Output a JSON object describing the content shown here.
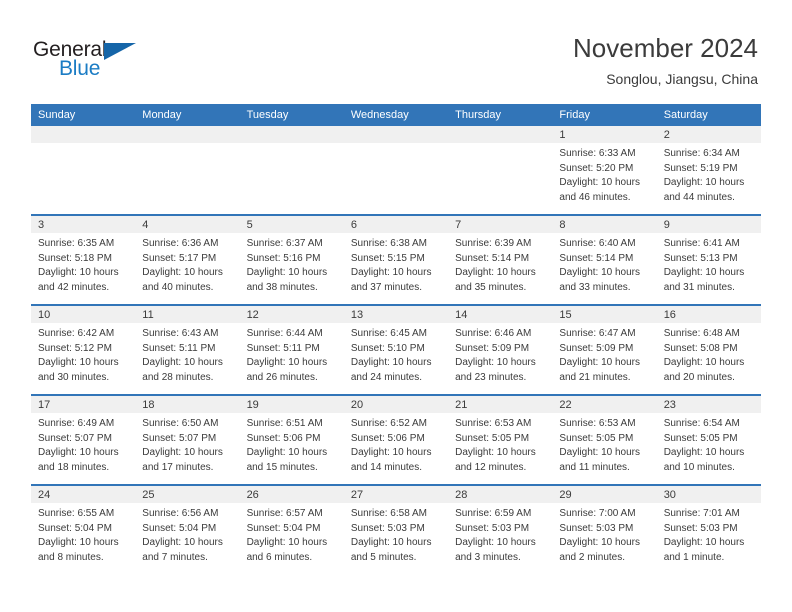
{
  "brand": {
    "name_part1": "General",
    "name_part2": "Blue",
    "triangle_icon": "triangle-icon",
    "color_dark": "#231f20",
    "color_blue": "#1b7cc4"
  },
  "header": {
    "title": "November 2024",
    "subtitle": "Songlou, Jiangsu, China"
  },
  "theme": {
    "header_blue": "#3275b8",
    "day_band_gray": "#f0f0f0",
    "text": "#3b3b3b"
  },
  "weekdays": [
    "Sunday",
    "Monday",
    "Tuesday",
    "Wednesday",
    "Thursday",
    "Friday",
    "Saturday"
  ],
  "weeks": [
    [
      {
        "day": "",
        "empty": true
      },
      {
        "day": "",
        "empty": true
      },
      {
        "day": "",
        "empty": true
      },
      {
        "day": "",
        "empty": true
      },
      {
        "day": "",
        "empty": true
      },
      {
        "day": "1",
        "sunrise": "Sunrise: 6:33 AM",
        "sunset": "Sunset: 5:20 PM",
        "daylight": "Daylight: 10 hours and 46 minutes."
      },
      {
        "day": "2",
        "sunrise": "Sunrise: 6:34 AM",
        "sunset": "Sunset: 5:19 PM",
        "daylight": "Daylight: 10 hours and 44 minutes."
      }
    ],
    [
      {
        "day": "3",
        "sunrise": "Sunrise: 6:35 AM",
        "sunset": "Sunset: 5:18 PM",
        "daylight": "Daylight: 10 hours and 42 minutes."
      },
      {
        "day": "4",
        "sunrise": "Sunrise: 6:36 AM",
        "sunset": "Sunset: 5:17 PM",
        "daylight": "Daylight: 10 hours and 40 minutes."
      },
      {
        "day": "5",
        "sunrise": "Sunrise: 6:37 AM",
        "sunset": "Sunset: 5:16 PM",
        "daylight": "Daylight: 10 hours and 38 minutes."
      },
      {
        "day": "6",
        "sunrise": "Sunrise: 6:38 AM",
        "sunset": "Sunset: 5:15 PM",
        "daylight": "Daylight: 10 hours and 37 minutes."
      },
      {
        "day": "7",
        "sunrise": "Sunrise: 6:39 AM",
        "sunset": "Sunset: 5:14 PM",
        "daylight": "Daylight: 10 hours and 35 minutes."
      },
      {
        "day": "8",
        "sunrise": "Sunrise: 6:40 AM",
        "sunset": "Sunset: 5:14 PM",
        "daylight": "Daylight: 10 hours and 33 minutes."
      },
      {
        "day": "9",
        "sunrise": "Sunrise: 6:41 AM",
        "sunset": "Sunset: 5:13 PM",
        "daylight": "Daylight: 10 hours and 31 minutes."
      }
    ],
    [
      {
        "day": "10",
        "sunrise": "Sunrise: 6:42 AM",
        "sunset": "Sunset: 5:12 PM",
        "daylight": "Daylight: 10 hours and 30 minutes."
      },
      {
        "day": "11",
        "sunrise": "Sunrise: 6:43 AM",
        "sunset": "Sunset: 5:11 PM",
        "daylight": "Daylight: 10 hours and 28 minutes."
      },
      {
        "day": "12",
        "sunrise": "Sunrise: 6:44 AM",
        "sunset": "Sunset: 5:11 PM",
        "daylight": "Daylight: 10 hours and 26 minutes."
      },
      {
        "day": "13",
        "sunrise": "Sunrise: 6:45 AM",
        "sunset": "Sunset: 5:10 PM",
        "daylight": "Daylight: 10 hours and 24 minutes."
      },
      {
        "day": "14",
        "sunrise": "Sunrise: 6:46 AM",
        "sunset": "Sunset: 5:09 PM",
        "daylight": "Daylight: 10 hours and 23 minutes."
      },
      {
        "day": "15",
        "sunrise": "Sunrise: 6:47 AM",
        "sunset": "Sunset: 5:09 PM",
        "daylight": "Daylight: 10 hours and 21 minutes."
      },
      {
        "day": "16",
        "sunrise": "Sunrise: 6:48 AM",
        "sunset": "Sunset: 5:08 PM",
        "daylight": "Daylight: 10 hours and 20 minutes."
      }
    ],
    [
      {
        "day": "17",
        "sunrise": "Sunrise: 6:49 AM",
        "sunset": "Sunset: 5:07 PM",
        "daylight": "Daylight: 10 hours and 18 minutes."
      },
      {
        "day": "18",
        "sunrise": "Sunrise: 6:50 AM",
        "sunset": "Sunset: 5:07 PM",
        "daylight": "Daylight: 10 hours and 17 minutes."
      },
      {
        "day": "19",
        "sunrise": "Sunrise: 6:51 AM",
        "sunset": "Sunset: 5:06 PM",
        "daylight": "Daylight: 10 hours and 15 minutes."
      },
      {
        "day": "20",
        "sunrise": "Sunrise: 6:52 AM",
        "sunset": "Sunset: 5:06 PM",
        "daylight": "Daylight: 10 hours and 14 minutes."
      },
      {
        "day": "21",
        "sunrise": "Sunrise: 6:53 AM",
        "sunset": "Sunset: 5:05 PM",
        "daylight": "Daylight: 10 hours and 12 minutes."
      },
      {
        "day": "22",
        "sunrise": "Sunrise: 6:53 AM",
        "sunset": "Sunset: 5:05 PM",
        "daylight": "Daylight: 10 hours and 11 minutes."
      },
      {
        "day": "23",
        "sunrise": "Sunrise: 6:54 AM",
        "sunset": "Sunset: 5:05 PM",
        "daylight": "Daylight: 10 hours and 10 minutes."
      }
    ],
    [
      {
        "day": "24",
        "sunrise": "Sunrise: 6:55 AM",
        "sunset": "Sunset: 5:04 PM",
        "daylight": "Daylight: 10 hours and 8 minutes."
      },
      {
        "day": "25",
        "sunrise": "Sunrise: 6:56 AM",
        "sunset": "Sunset: 5:04 PM",
        "daylight": "Daylight: 10 hours and 7 minutes."
      },
      {
        "day": "26",
        "sunrise": "Sunrise: 6:57 AM",
        "sunset": "Sunset: 5:04 PM",
        "daylight": "Daylight: 10 hours and 6 minutes."
      },
      {
        "day": "27",
        "sunrise": "Sunrise: 6:58 AM",
        "sunset": "Sunset: 5:03 PM",
        "daylight": "Daylight: 10 hours and 5 minutes."
      },
      {
        "day": "28",
        "sunrise": "Sunrise: 6:59 AM",
        "sunset": "Sunset: 5:03 PM",
        "daylight": "Daylight: 10 hours and 3 minutes."
      },
      {
        "day": "29",
        "sunrise": "Sunrise: 7:00 AM",
        "sunset": "Sunset: 5:03 PM",
        "daylight": "Daylight: 10 hours and 2 minutes."
      },
      {
        "day": "30",
        "sunrise": "Sunrise: 7:01 AM",
        "sunset": "Sunset: 5:03 PM",
        "daylight": "Daylight: 10 hours and 1 minute."
      }
    ]
  ]
}
